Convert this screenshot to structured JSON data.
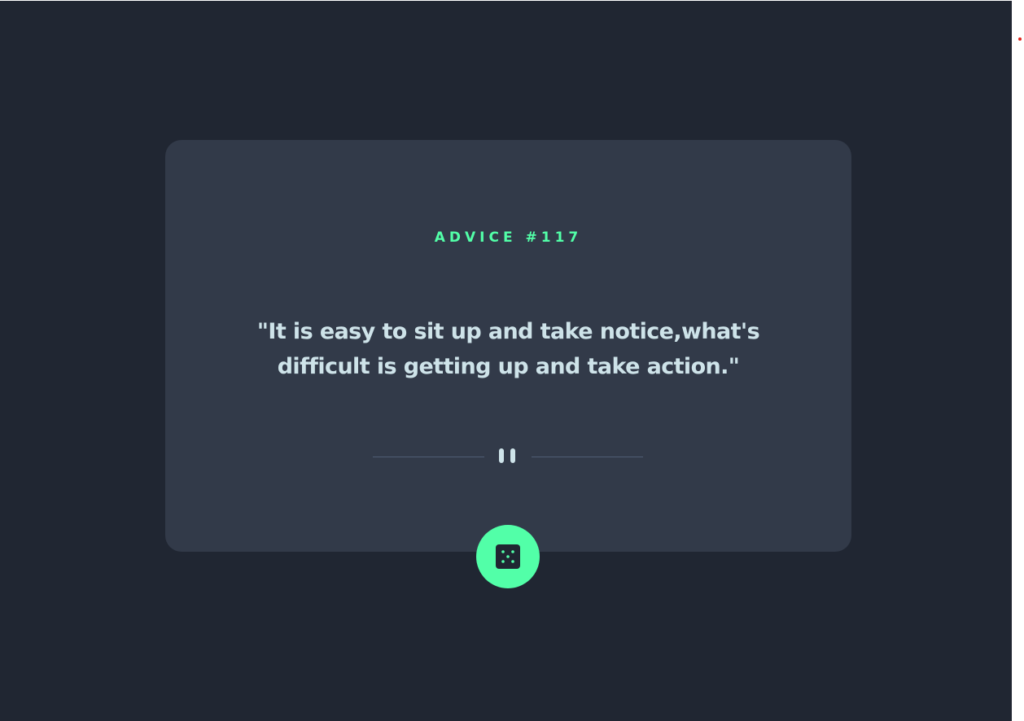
{
  "advice": {
    "id_label": "ADVICE #117",
    "quote": "\"It is easy to sit up and take notice,what's difficult is getting up and take action.\""
  },
  "icons": {
    "divider": "pause-icon",
    "button": "dice-icon"
  },
  "colors": {
    "background": "#202632",
    "card": "#323a49",
    "accent": "#52ffa8",
    "text": "#cee3e9",
    "divider_line": "#4f5d74"
  }
}
